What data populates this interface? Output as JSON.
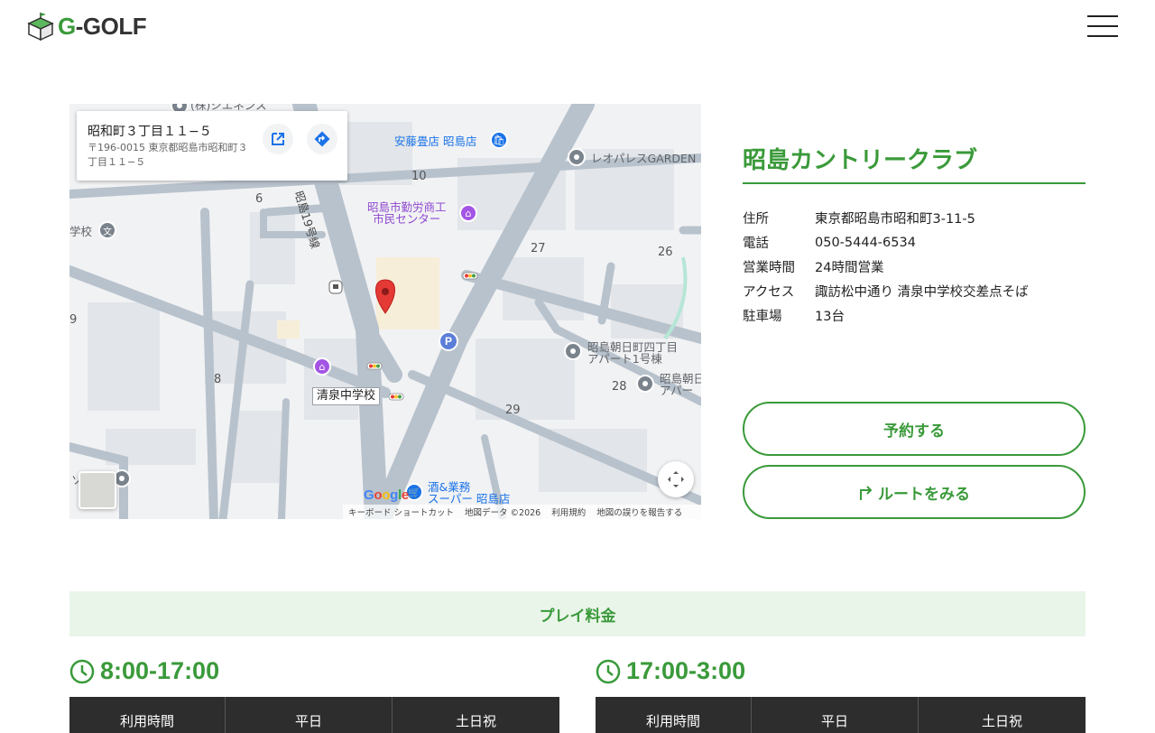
{
  "header": {
    "logo_text_g": "G",
    "logo_text_rest": "-GOLF",
    "menu_icon": "hamburger-menu-icon"
  },
  "map": {
    "card": {
      "title": "昭和町３丁目１１−５",
      "address": "〒196-0015 東京都昭島市昭和町３丁目１１−５",
      "open_icon": "open-in-new-icon",
      "directions_icon": "directions-icon"
    },
    "labels": {
      "shine": "(株)シエネンス",
      "ando": "安藤畳店 昭島店",
      "leo": "レオパレスGARDEN",
      "kinro": "昭島市勤労商工\n市民センター",
      "school_left": "学校",
      "route": "昭島19号線",
      "asahi": "昭島朝日町四丁目\nアパート1号棟",
      "asahi2": "昭島朝日\nアパー",
      "kiyosumi": "清泉中学校",
      "sake": "酒&業務\nスーパー 昭島店",
      "n10": "10",
      "n6": "6",
      "n27": "27",
      "n26": "26",
      "n9": "9",
      "n8": "8",
      "n28": "28",
      "n29": "29",
      "p": "P",
      "ku": "ソ"
    },
    "google": "Google",
    "attribution": [
      "キーボード ショートカット",
      "地図データ ©2026",
      "利用規約",
      "地図の誤りを報告する"
    ]
  },
  "info": {
    "title": "昭島カントリークラブ",
    "rows": [
      {
        "k": "住所",
        "v": "東京都昭島市昭和町3-11-5"
      },
      {
        "k": "電話",
        "v": "050-5444-6534"
      },
      {
        "k": "営業時間",
        "v": "24時間営業"
      },
      {
        "k": "アクセス",
        "v": "諏訪松中通り 清泉中学校交差点そば"
      },
      {
        "k": "駐車場",
        "v": "13台"
      }
    ],
    "reserve_label": "予約する",
    "route_label": "ルートをみる"
  },
  "pricing": {
    "band_label": "プレイ料金",
    "periods": [
      {
        "time": "8:00-17:00",
        "headers": [
          "利用時間",
          "平日",
          "土日祝"
        ]
      },
      {
        "time": "17:00-3:00",
        "headers": [
          "利用時間",
          "平日",
          "土日祝"
        ]
      }
    ]
  },
  "colors": {
    "accent": "#3a9a3a",
    "band": "#eaf5ea",
    "table_header": "#2d2d2d"
  }
}
